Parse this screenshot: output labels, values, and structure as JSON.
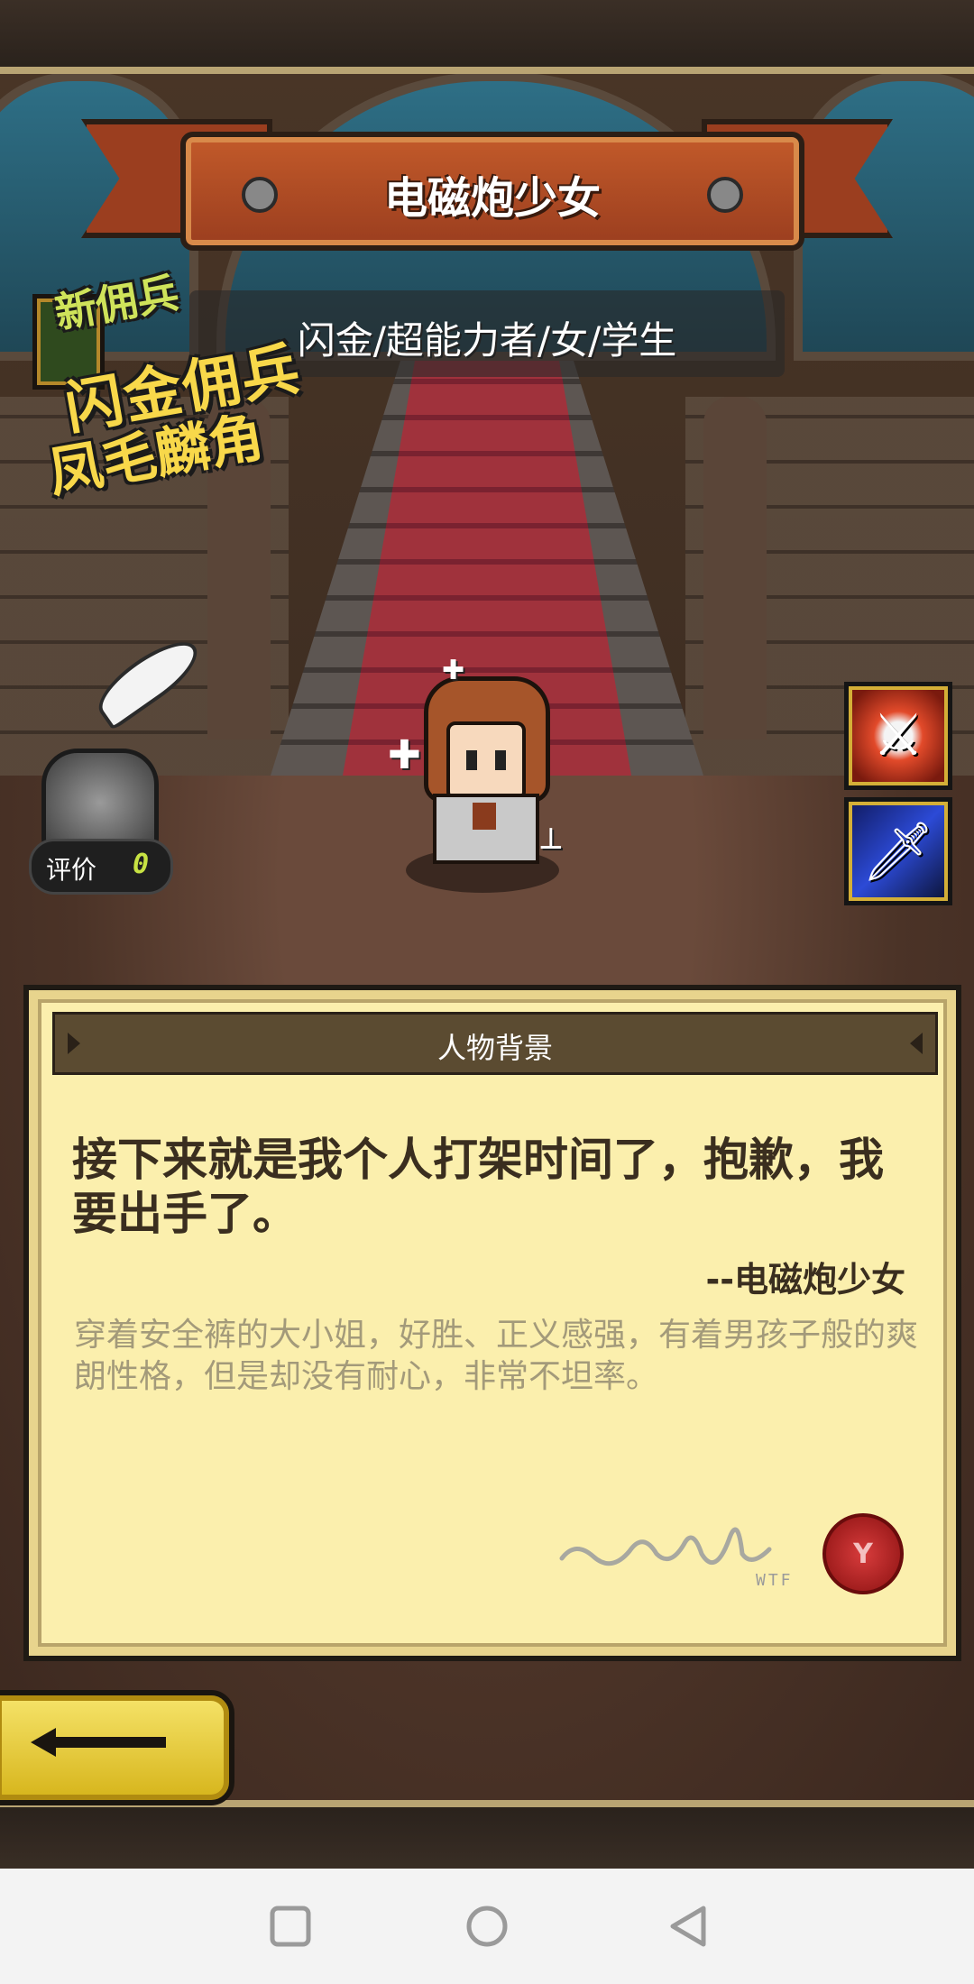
{
  "title_banner": {
    "character_name": "电磁炮少女"
  },
  "character_tags": "闪金/超能力者/女/学生",
  "promo_badge": {
    "line1": "新佣兵",
    "line2": "闪金佣兵",
    "line3": "凤毛麟角"
  },
  "rating": {
    "label": "评价",
    "value": "0"
  },
  "skills": [
    {
      "icon": "slash-attack-icon",
      "glyph": "⚔"
    },
    {
      "icon": "blue-sword-icon",
      "glyph": "🗡"
    }
  ],
  "background_panel": {
    "header": "人物背景",
    "quote": "接下来就是我个人打架时间了，抱歉，我要出手了。",
    "quote_author": "--电磁炮少女",
    "bio": "穿着安全裤的大小姐，好胜、正义感强，有着男孩子般的爽朗性格，但是却没有耐心，非常不坦率。",
    "signature_caption": "WTF",
    "seal_glyph": "Y"
  },
  "back_button": {
    "icon": "left-arrow-icon"
  },
  "system_nav": {
    "recent": "square-icon",
    "home": "circle-icon",
    "back": "triangle-back-icon"
  },
  "colors": {
    "panel_bg": "#fbefad",
    "banner_red": "#9b3e1f",
    "accent_yellow": "#f8d84a",
    "rating_green": "#c7e243"
  }
}
